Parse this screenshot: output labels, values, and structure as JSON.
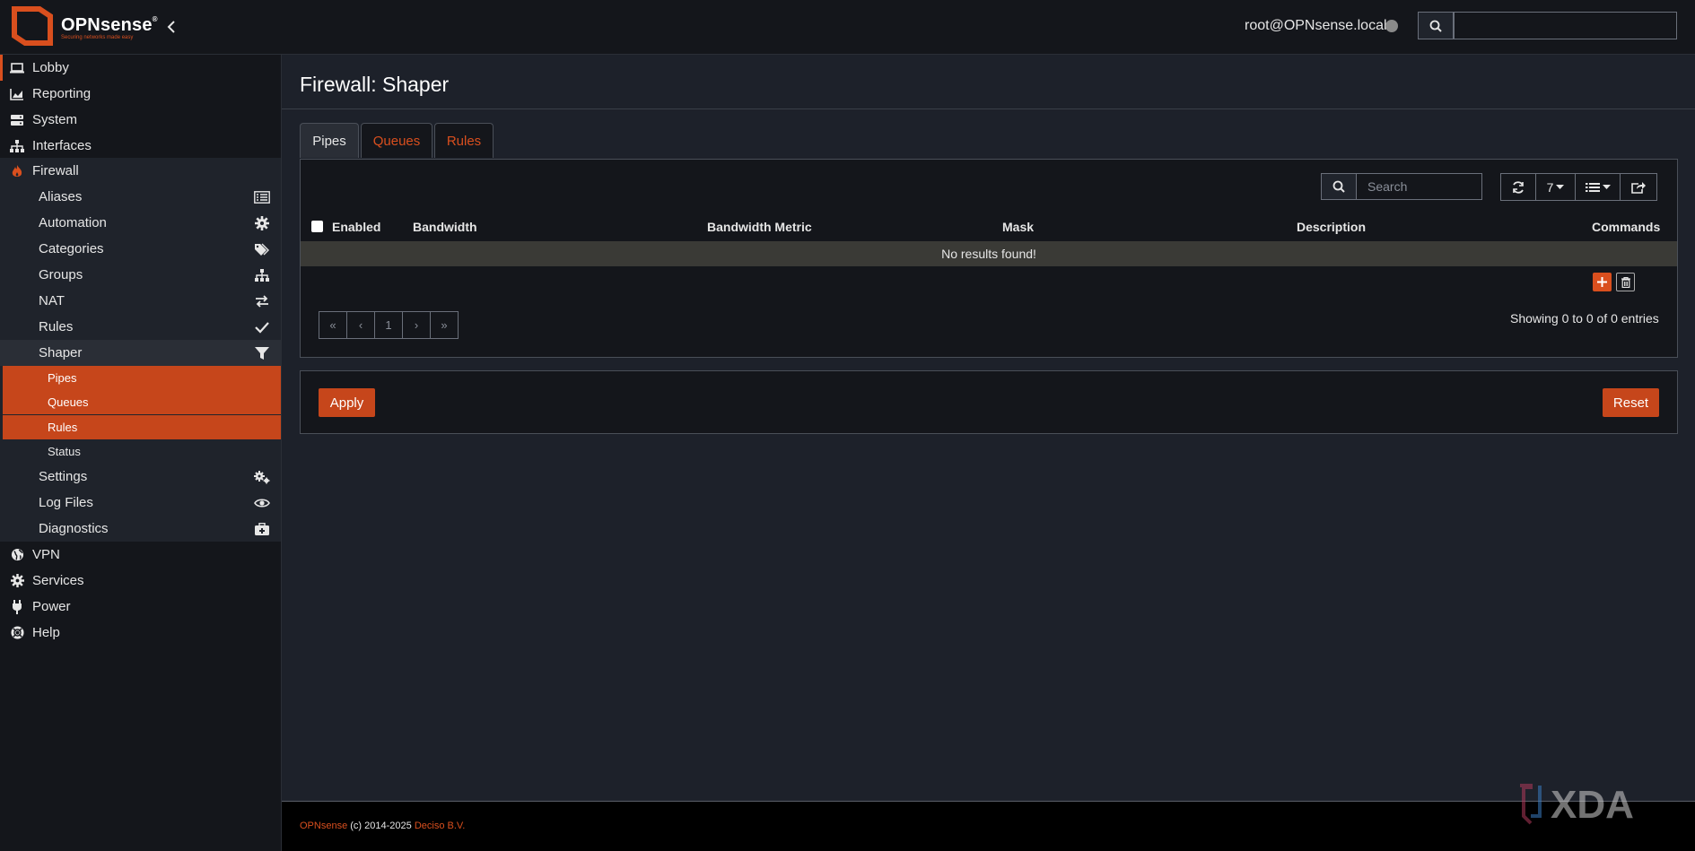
{
  "header": {
    "brand": "OPNsense",
    "tagline": "Securing networks made easy",
    "user": "root@OPNsense.local"
  },
  "sidebar": {
    "top_items": [
      {
        "label": "Lobby",
        "icon": "laptop-icon"
      },
      {
        "label": "Reporting",
        "icon": "area-chart-icon"
      },
      {
        "label": "System",
        "icon": "server-icon"
      },
      {
        "label": "Interfaces",
        "icon": "sitemap-icon"
      },
      {
        "label": "Firewall",
        "icon": "fire-icon"
      }
    ],
    "firewall_items": [
      {
        "label": "Aliases",
        "icon": "list-alt-icon"
      },
      {
        "label": "Automation",
        "icon": "gear-icon"
      },
      {
        "label": "Categories",
        "icon": "tags-icon"
      },
      {
        "label": "Groups",
        "icon": "sitemap-icon"
      },
      {
        "label": "NAT",
        "icon": "exchange-icon"
      },
      {
        "label": "Rules",
        "icon": "check-icon"
      },
      {
        "label": "Shaper",
        "icon": "filter-icon"
      }
    ],
    "shaper_items": [
      {
        "label": "Pipes"
      },
      {
        "label": "Queues"
      },
      {
        "label": "Rules"
      },
      {
        "label": "Status"
      }
    ],
    "firewall_items_after": [
      {
        "label": "Settings",
        "icon": "gears-icon"
      },
      {
        "label": "Log Files",
        "icon": "eye-icon"
      },
      {
        "label": "Diagnostics",
        "icon": "medkit-icon"
      }
    ],
    "bottom_items": [
      {
        "label": "VPN",
        "icon": "globe-icon"
      },
      {
        "label": "Services",
        "icon": "gear-icon"
      },
      {
        "label": "Power",
        "icon": "plug-icon"
      },
      {
        "label": "Help",
        "icon": "life-ring-icon"
      }
    ]
  },
  "page": {
    "title": "Firewall: Shaper",
    "tabs": [
      {
        "label": "Pipes",
        "active": true
      },
      {
        "label": "Queues",
        "active": false
      },
      {
        "label": "Rules",
        "active": false
      }
    ]
  },
  "grid": {
    "search_placeholder": "Search",
    "page_size": "7",
    "columns": [
      "Enabled",
      "Bandwidth",
      "Bandwidth Metric",
      "Mask",
      "Description",
      "Commands"
    ],
    "no_results": "No results found!",
    "pager": [
      "«",
      "‹",
      "1",
      "›",
      "»"
    ],
    "showing": "Showing 0 to 0 of 0 entries"
  },
  "actions": {
    "apply": "Apply",
    "reset": "Reset"
  },
  "footer": {
    "brand": "OPNsense",
    "copyright": " (c) 2014-2025 ",
    "company": "Deciso B.V."
  },
  "watermark": "XDA",
  "colors": {
    "accent": "#d94f1e",
    "background": "#1d212a",
    "sidebar": "#14161b"
  }
}
